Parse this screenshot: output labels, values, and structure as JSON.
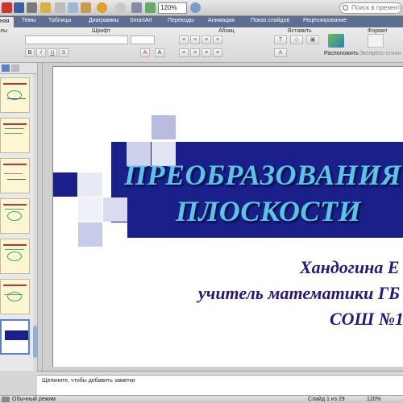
{
  "toolbar": {
    "zoom_value": "120%",
    "search_placeholder": "Поиск в презентации"
  },
  "ribbon_tabs": [
    {
      "label": "Главная",
      "visible_label": "ная",
      "active": true
    },
    {
      "label": "Темы"
    },
    {
      "label": "Таблицы"
    },
    {
      "label": "Диаграммы"
    },
    {
      "label": "SmartArt"
    },
    {
      "label": "Переходы"
    },
    {
      "label": "Анимация"
    },
    {
      "label": "Показ слайдов"
    },
    {
      "label": "Рецензирование"
    }
  ],
  "ribbon": {
    "groups": {
      "slides": "лы",
      "font": "Шрифт",
      "paragraph": "Абзац",
      "insert": "Вставить",
      "format": "Формат"
    },
    "arrange_label": "Расположить",
    "quick_styles_label": "Экспресс-стили"
  },
  "slide": {
    "title_line1": "ПРЕОБРАЗОВАНИЯ",
    "title_line2": "ПЛОСКОСТИ",
    "author_line1": "Хандогина Е",
    "author_line2": "учитель математики ГБ",
    "author_line3": "СОШ №1"
  },
  "notes_placeholder": "Щелкните, чтобы добавить заметки",
  "status": {
    "view_mode": "Обычный режим",
    "slide_counter": "Слайд 1 из 29",
    "zoom": "120%"
  },
  "colors": {
    "tab_bar": "#5c6f92",
    "slide_band": "#1a1f8a",
    "title_text": "#5bc4e6",
    "author_text": "#2a167c",
    "thumb_bg": "#fcf7d0"
  },
  "icons": [
    "save-icon",
    "print-icon",
    "undo-icon",
    "redo-icon",
    "search-icon",
    "chevron-down-icon"
  ]
}
